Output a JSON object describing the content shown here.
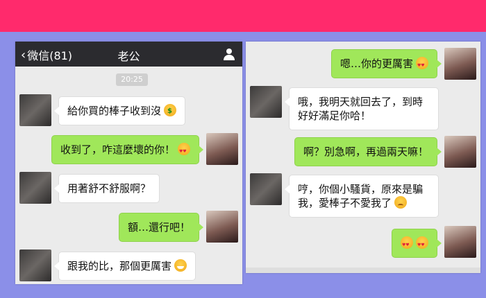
{
  "left": {
    "header": {
      "back_label": "微信(81)",
      "title": "老公"
    },
    "timestamp": "20:25",
    "messages": [
      {
        "from": "him",
        "text": "給你買的棒子收到沒"
      },
      {
        "from": "her",
        "text": "收到了，咋這麼壞的你！"
      },
      {
        "from": "him",
        "text": "用著舒不舒服啊？"
      },
      {
        "from": "her",
        "text": "額…還行吧！"
      },
      {
        "from": "him",
        "text": "跟我的比，那個更厲害"
      }
    ]
  },
  "right": {
    "messages": [
      {
        "from": "her",
        "text": "嗯…你的更厲害"
      },
      {
        "from": "him",
        "text": "哦，我明天就回去了，到時好好滿足你哈！"
      },
      {
        "from": "her",
        "text": "啊？別急啊，再過兩天嘛！"
      },
      {
        "from": "him",
        "text": "哼，你個小騷貨，原來是騙我，愛棒子不愛我了"
      },
      {
        "from": "her",
        "text": ""
      }
    ]
  },
  "colors": {
    "top_bg": "#ff2a6c",
    "bottom_bg": "#8b8fe8",
    "bubble_out": "#a0e75a",
    "header": "#2b2b2f"
  }
}
